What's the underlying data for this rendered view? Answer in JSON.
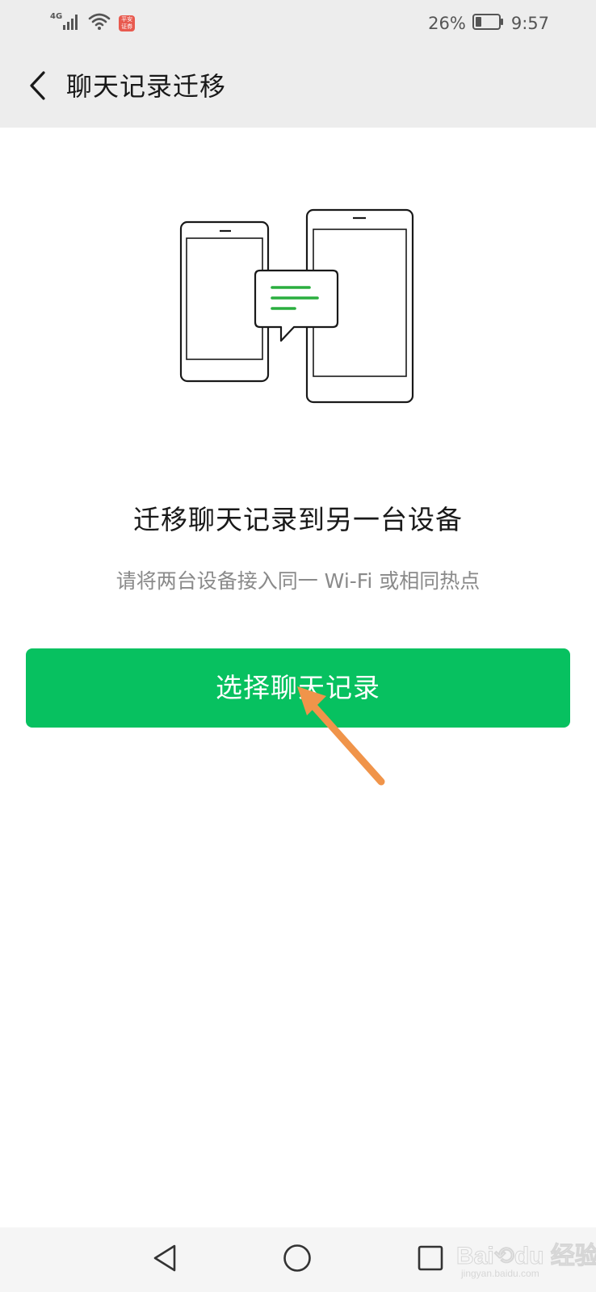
{
  "status_bar": {
    "network_type": "4G",
    "app_badge_text": "平安证券",
    "battery_percent": "26%",
    "battery_level": 0.26,
    "time": "9:57",
    "icons": [
      "signal-icon",
      "wifi-icon",
      "battery-icon"
    ]
  },
  "header": {
    "title": "聊天记录迁移",
    "back_icon": "chevron-left-icon"
  },
  "content": {
    "illustration_icon": "phones-transfer-icon",
    "heading": "迁移聊天记录到另一台设备",
    "subtext": "请将两台设备接入同一 Wi-Fi 或相同热点",
    "button_label": "选择聊天记录",
    "annotation_icon": "orange-arrow-icon"
  },
  "nav": {
    "icons": [
      "nav-back-icon",
      "nav-home-icon",
      "nav-recent-icon"
    ]
  },
  "watermark": {
    "main": "Bai⟲du 经验",
    "sub": "jingyan.baidu.com"
  },
  "colors": {
    "accent_green": "#07c160",
    "header_bg": "#ededed",
    "annotation_orange": "#f0944a",
    "illustration_line_green": "#2aae3f"
  }
}
